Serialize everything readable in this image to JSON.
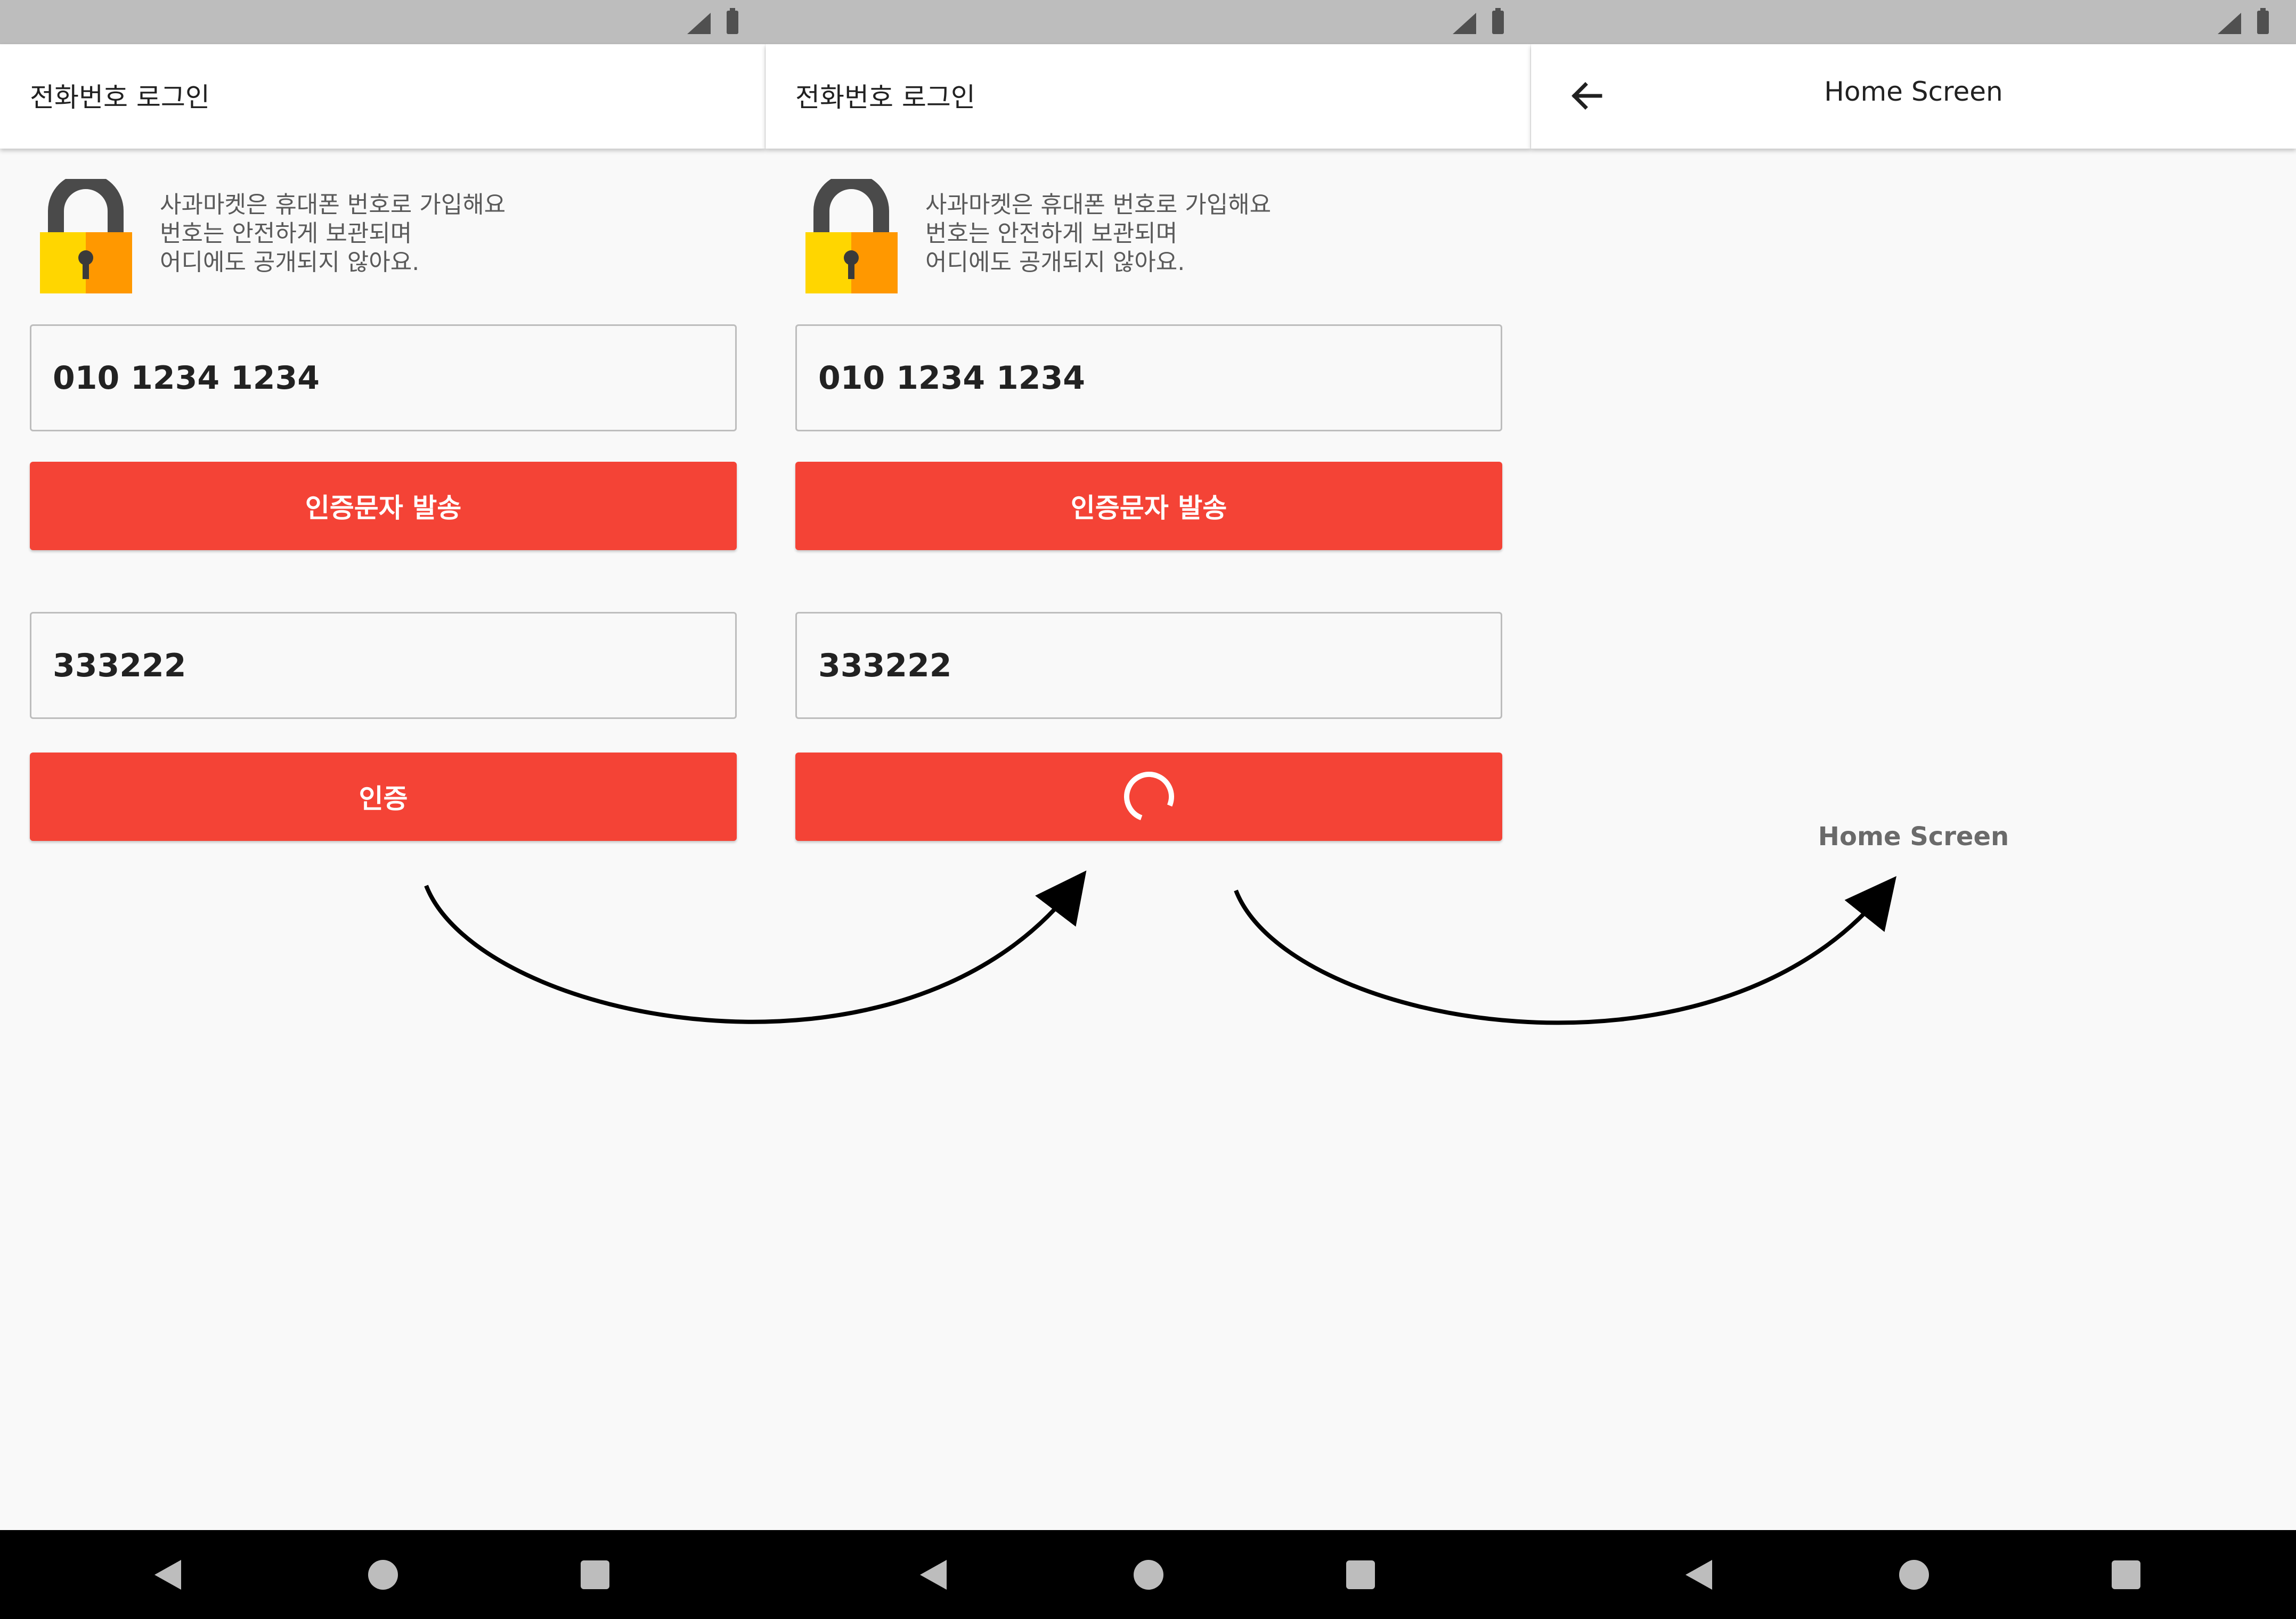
{
  "screens": [
    {
      "app_bar_title": "전화번호 로그인",
      "info_text": "사과마켓은 휴대폰 번호로 가입해요\n번호는 안전하게 보관되며\n어디에도 공개되지 않아요.",
      "phone_input_value": "010 1234 1234",
      "send_code_button_label": "인증문자 발송",
      "code_input_value": "333222",
      "verify_button_label": "인증"
    },
    {
      "app_bar_title": "전화번호 로그인",
      "info_text": "사과마켓은 휴대폰 번호로 가입해요\n번호는 안전하게 보관되며\n어디에도 공개되지 않아요.",
      "phone_input_value": "010 1234 1234",
      "send_code_button_label": "인증문자 발송",
      "code_input_value": "333222",
      "verify_button_state": "loading"
    },
    {
      "app_bar_title": "Home Screen",
      "body_text": "Home Screen"
    }
  ],
  "icons": {
    "status": [
      "signal-icon",
      "battery-icon"
    ],
    "lock": "lock-icon",
    "back": "back-arrow-icon",
    "spinner": "loading-spinner-icon",
    "nav": [
      "nav-back-icon",
      "nav-home-icon",
      "nav-recents-icon"
    ]
  },
  "colors": {
    "accent": "#f44336",
    "status_bar": "#bdbdbd",
    "background": "#f9f9f9",
    "nav_bar": "#000000"
  }
}
